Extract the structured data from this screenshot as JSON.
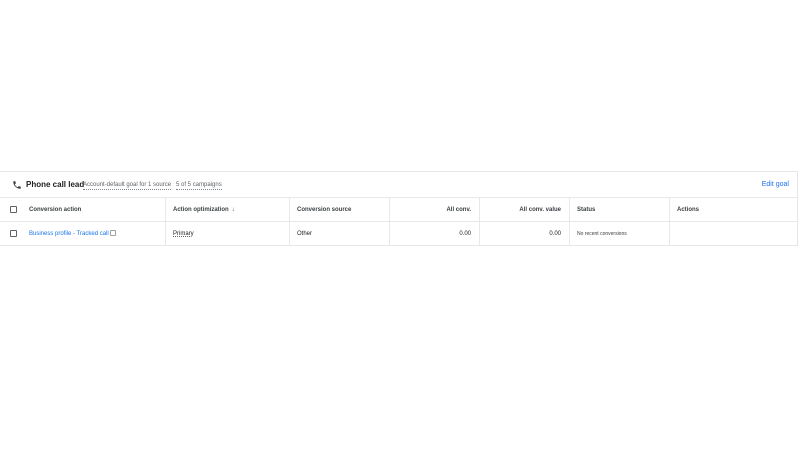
{
  "goal": {
    "title": "Phone call lead",
    "default_label": "Account-default goal for 1 source",
    "campaigns_label": "5 of 5 campaigns",
    "edit_label": "Edit goal"
  },
  "table": {
    "headers": {
      "action": "Conversion action",
      "optimization": "Action optimization",
      "sort_arrow": "↓",
      "source": "Conversion source",
      "all_conv": "All conv.",
      "all_conv_value": "All conv. value",
      "status": "Status",
      "actions": "Actions"
    },
    "rows": [
      {
        "action": "Business profile - Tracked call",
        "optimization": "Primary",
        "source": "Other",
        "all_conv": "0.00",
        "all_conv_value": "0.00",
        "status": "No recent conversions",
        "actions": ""
      }
    ]
  },
  "icons": {
    "phone": "phone-icon",
    "info": "info-icon",
    "sort": "arrow-down-icon",
    "checkbox": "checkbox-icon"
  },
  "colors": {
    "link": "#1a73e8",
    "border": "#e8e8e8",
    "text": "#202124"
  }
}
